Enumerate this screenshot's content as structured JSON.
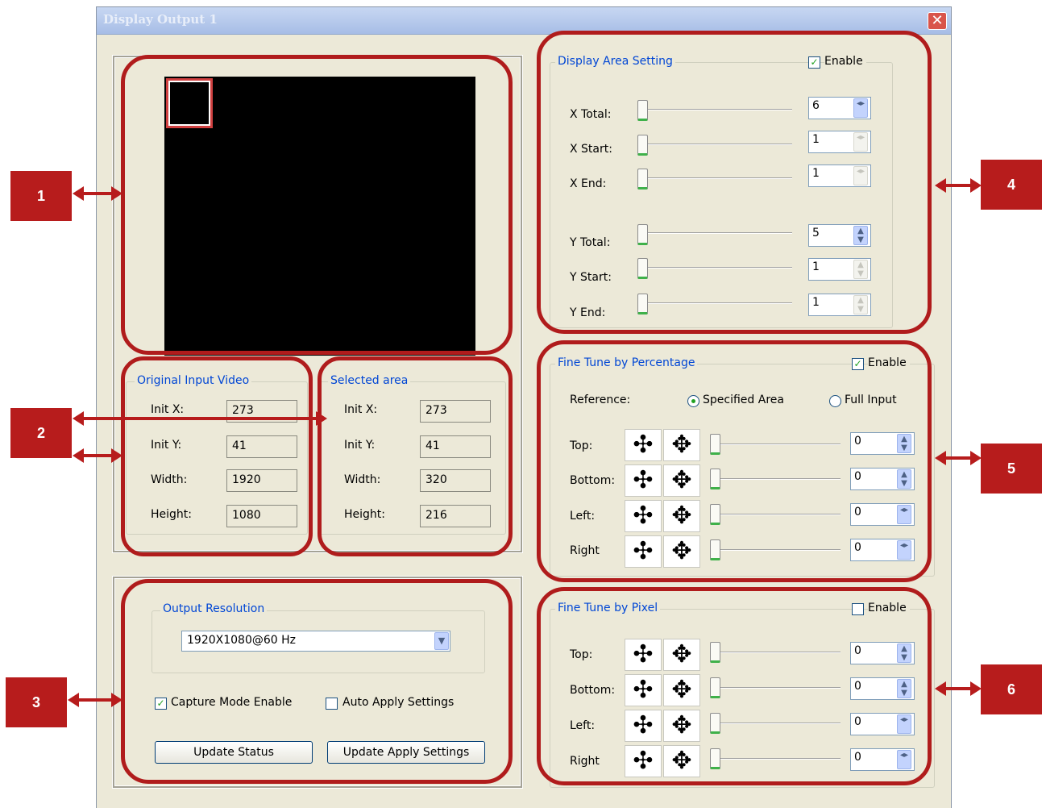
{
  "window": {
    "title": "Display Output 1",
    "close_glyph": "✕"
  },
  "preview": {
    "frame_color": "#000000",
    "selection_color": "#d04040"
  },
  "original_input": {
    "title": "Original Input Video",
    "fields": [
      {
        "label": "Init X:",
        "value": "273"
      },
      {
        "label": "Init Y:",
        "value": "41"
      },
      {
        "label": "Width:",
        "value": "1920"
      },
      {
        "label": "Height:",
        "value": "1080"
      }
    ]
  },
  "selected_area": {
    "title": "Selected area",
    "fields": [
      {
        "label": "Init X:",
        "value": "273"
      },
      {
        "label": "Init Y:",
        "value": "41"
      },
      {
        "label": "Width:",
        "value": "320"
      },
      {
        "label": "Height:",
        "value": "216"
      }
    ]
  },
  "output": {
    "resolution_title": "Output Resolution",
    "resolution_value": "1920X1080@60 Hz",
    "capture_mode_label": "Capture Mode Enable",
    "capture_mode_checked": true,
    "auto_apply_label": "Auto Apply Settings",
    "auto_apply_checked": false,
    "update_status_label": "Update Status",
    "update_apply_label": "Update Apply Settings"
  },
  "display_area": {
    "title": "Display Area Setting",
    "enable_label": "Enable",
    "enabled": true,
    "rows": [
      {
        "label": "X Total:",
        "value": "6"
      },
      {
        "label": "X Start:",
        "value": "1"
      },
      {
        "label": "X End:",
        "value": "1"
      },
      {
        "label": "Y Total:",
        "value": "5"
      },
      {
        "label": "Y Start:",
        "value": "1"
      },
      {
        "label": "Y End:",
        "value": "1"
      }
    ]
  },
  "fine_percent": {
    "title": "Fine Tune by Percentage",
    "enable_label": "Enable",
    "enabled": true,
    "reference_label": "Reference:",
    "ref_specified": "Specified Area",
    "ref_full": "Full Input",
    "ref_selected": "Specified Area",
    "rows": [
      {
        "label": "Top:",
        "value": "0"
      },
      {
        "label": "Bottom:",
        "value": "0"
      },
      {
        "label": "Left:",
        "value": "0"
      },
      {
        "label": "Right",
        "value": "0"
      }
    ]
  },
  "fine_pixel": {
    "title": "Fine Tune by Pixel",
    "enable_label": "Enable",
    "enabled": false,
    "rows": [
      {
        "label": "Top:",
        "value": "0"
      },
      {
        "label": "Bottom:",
        "value": "0"
      },
      {
        "label": "Left:",
        "value": "0"
      },
      {
        "label": "Right",
        "value": "0"
      }
    ]
  },
  "icons": {
    "shrink": "shrink-arrows-icon",
    "expand": "expand-arrows-icon",
    "check": "✓"
  },
  "callouts": [
    "1",
    "2",
    "3",
    "4",
    "5",
    "6"
  ],
  "callout_color": "#b71c1c"
}
